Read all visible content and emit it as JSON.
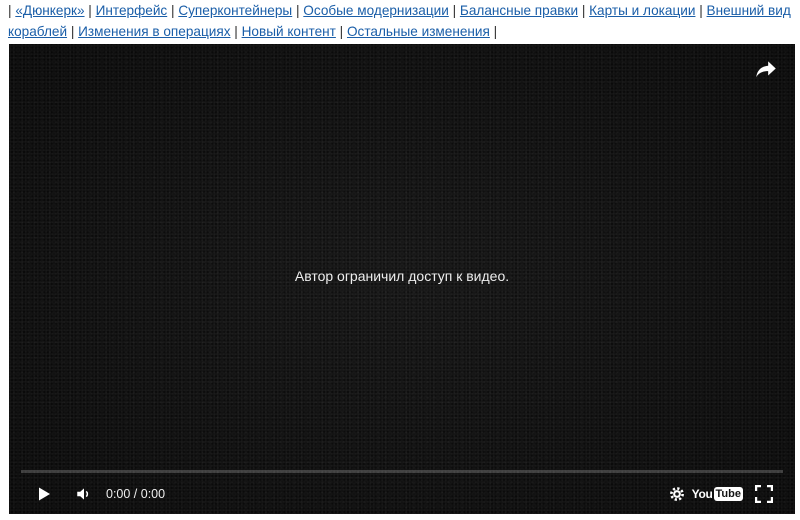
{
  "nav": {
    "links": [
      "«Дюнкерк»",
      "Интерфейс",
      "Суперконтейнеры",
      "Особые модернизации",
      "Балансные правки",
      "Карты и локации",
      "Внешний вид кораблей",
      "Изменения в операциях",
      "Новый контент",
      "Остальные изменения"
    ],
    "separator": "|"
  },
  "player": {
    "message": "Автор ограничил доступ к видео.",
    "time": "0:00 / 0:00",
    "logo_you": "You",
    "logo_tube": "Tube",
    "progress": 0,
    "icons": {
      "share": "share-icon",
      "play": "play-icon",
      "volume": "volume-icon",
      "settings": "gear-icon",
      "fullscreen": "fullscreen-icon"
    }
  }
}
